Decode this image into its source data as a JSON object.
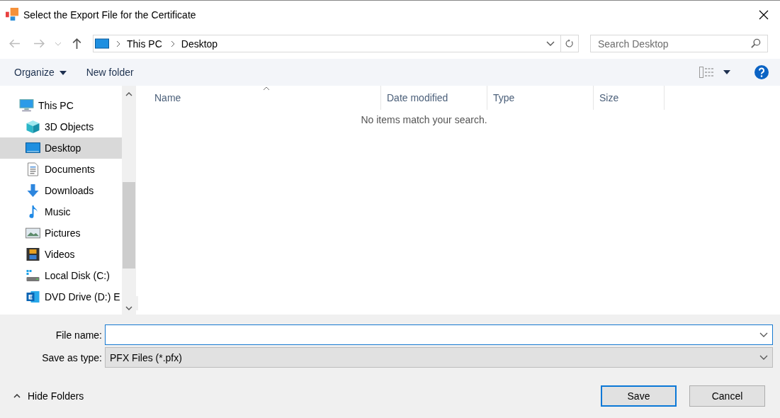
{
  "window": {
    "title": "Select the Export File for the Certificate"
  },
  "address": {
    "crumbs": [
      "This PC",
      "Desktop"
    ]
  },
  "search": {
    "placeholder": "Search Desktop"
  },
  "toolbar": {
    "organize": "Organize",
    "new_folder": "New folder"
  },
  "sidebar": {
    "items": [
      {
        "label": "This PC",
        "kind": "pc",
        "selected": false,
        "children": [
          {
            "label": "3D Objects",
            "kind": "cube",
            "selected": false
          },
          {
            "label": "Desktop",
            "kind": "desktop",
            "selected": true
          },
          {
            "label": "Documents",
            "kind": "document",
            "selected": false
          },
          {
            "label": "Downloads",
            "kind": "download",
            "selected": false
          },
          {
            "label": "Music",
            "kind": "music",
            "selected": false
          },
          {
            "label": "Pictures",
            "kind": "pictures",
            "selected": false
          },
          {
            "label": "Videos",
            "kind": "videos",
            "selected": false
          },
          {
            "label": "Local Disk (C:)",
            "kind": "disk",
            "selected": false
          },
          {
            "label": "DVD Drive (D:) E",
            "kind": "exchange",
            "selected": false
          }
        ]
      }
    ]
  },
  "table": {
    "columns": [
      "Name",
      "Date modified",
      "Type",
      "Size"
    ],
    "empty_message": "No items match your search."
  },
  "form": {
    "file_name_label": "File name:",
    "type_label": "Save as type:",
    "type_value": "PFX Files (*.pfx)"
  },
  "hide_folders": "Hide Folders",
  "buttons": [
    "Save",
    "Cancel"
  ]
}
